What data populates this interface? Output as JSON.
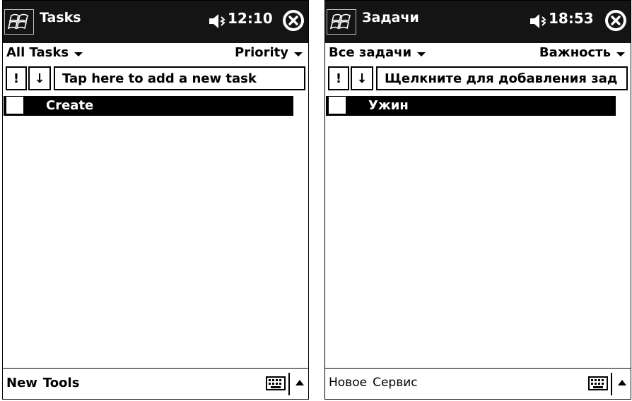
{
  "screens": [
    {
      "title": "Tasks",
      "clock": "12:10",
      "filter": "All Tasks",
      "sort": "Priority",
      "priority_symbol": "!",
      "sort_symbol": "↓",
      "new_task_placeholder": "Tap here to add a new task",
      "tasks": [
        {
          "name": "Create",
          "checked": false
        }
      ],
      "softkeys": [
        "New",
        "Tools"
      ]
    },
    {
      "title": "Задачи",
      "clock": "18:53",
      "filter": "Все задачи",
      "sort": "Важность",
      "priority_symbol": "!",
      "sort_symbol": "↓",
      "new_task_placeholder": "Щелкните для добавления зад",
      "tasks": [
        {
          "name": "Ужин",
          "checked": false
        }
      ],
      "softkeys": [
        "Новое",
        "Сервис"
      ]
    }
  ],
  "icons": {
    "start": "windows-start-icon",
    "volume": "speaker-icon",
    "close": "close-icon",
    "keyboard": "keyboard-icon",
    "sip": "chevron-up-icon"
  }
}
